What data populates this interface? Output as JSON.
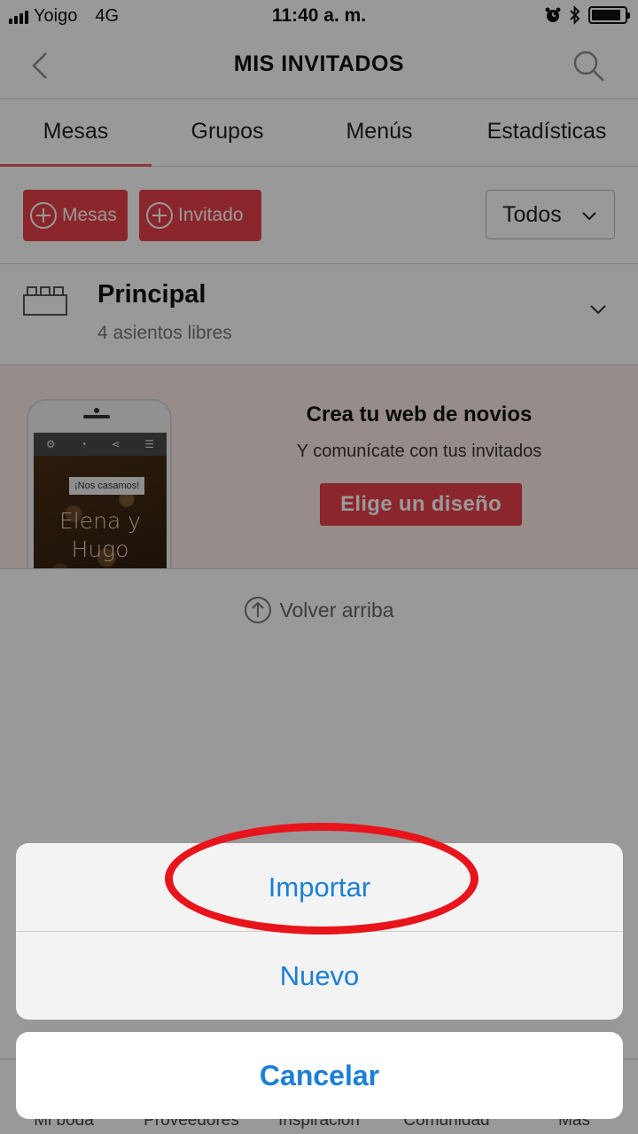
{
  "status_bar": {
    "carrier": "Yoigo",
    "network": "4G",
    "time": "11:40 a. m.",
    "battery_level": 0.9
  },
  "header": {
    "title": "MIS INVITADOS"
  },
  "tabs": [
    {
      "label": "Mesas",
      "active": true
    },
    {
      "label": "Grupos",
      "active": false
    },
    {
      "label": "Menús",
      "active": false
    },
    {
      "label": "Estadísticas",
      "active": false
    }
  ],
  "toolbar": {
    "add_table_label": "Mesas",
    "add_guest_label": "Invitado",
    "filter_value": "Todos"
  },
  "table": {
    "name": "Principal",
    "seats": "4 asientos libres"
  },
  "promo": {
    "title": "Crea tu web de novios",
    "subtitle": "Y comunícate con tus invitados",
    "button": "Elige un diseño",
    "phone_tag": "¡Nos casamos!",
    "phone_names_1": "Elena y",
    "phone_names_2": "Hugo"
  },
  "back_to_top": "Volver arriba",
  "tab_bar": [
    "Mi boda",
    "Proveedores",
    "Inspiración",
    "Comunidad",
    "Más"
  ],
  "action_sheet": {
    "import": "Importar",
    "new": "Nuevo",
    "cancel": "Cancelar"
  },
  "colors": {
    "accent": "#e8404a",
    "action_blue": "#1b7fd8",
    "highlight": "#e8141b"
  }
}
